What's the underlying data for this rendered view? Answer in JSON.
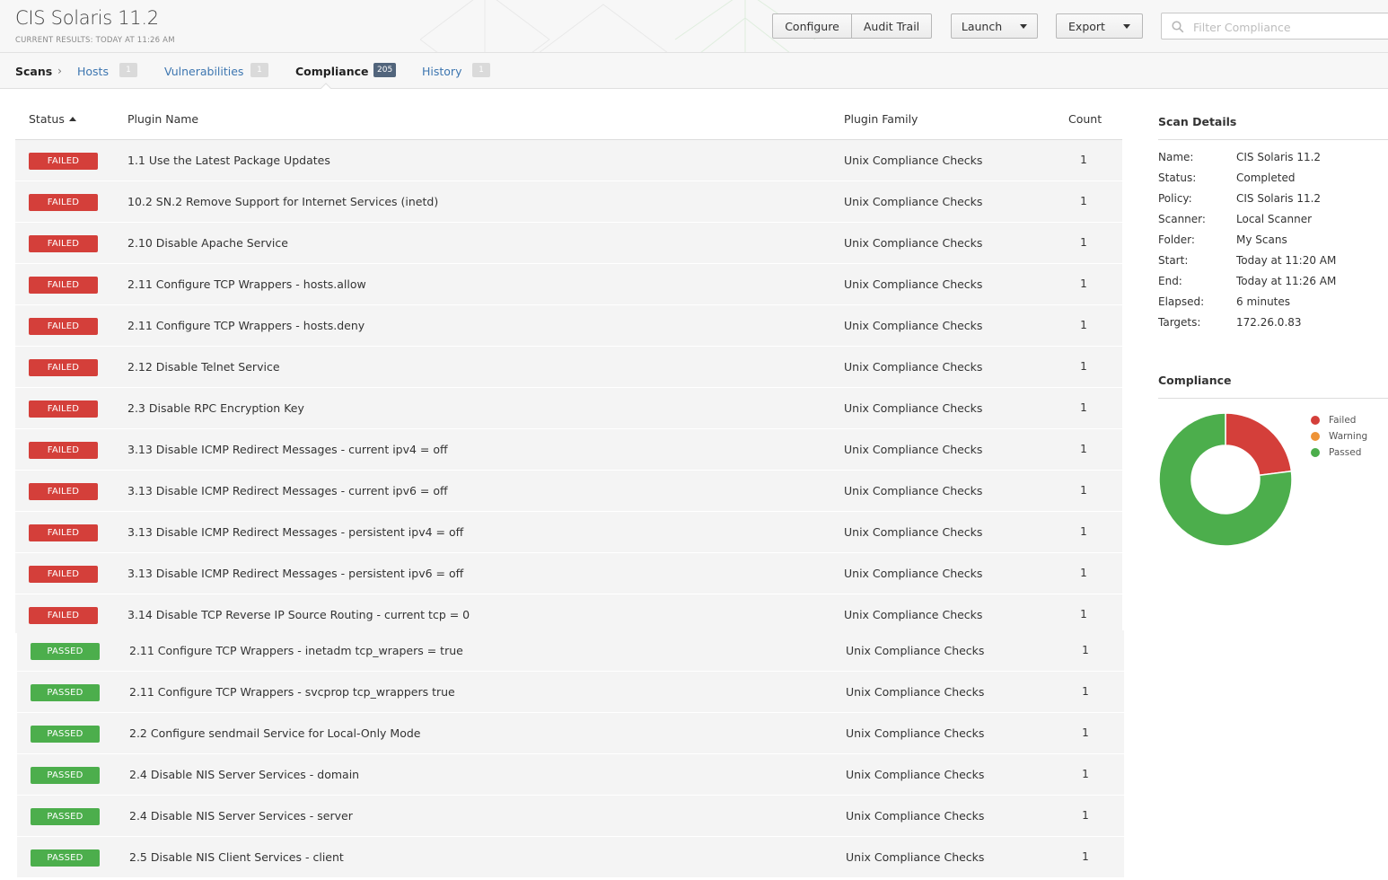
{
  "header": {
    "title": "CIS Solaris 11.2",
    "subtitle": "CURRENT RESULTS: TODAY AT 11:26 AM",
    "configure_label": "Configure",
    "audit_trail_label": "Audit Trail",
    "launch_label": "Launch",
    "export_label": "Export",
    "search_placeholder": "Filter Compliance"
  },
  "nav": {
    "root": "Scans",
    "tabs": [
      {
        "label": "Hosts",
        "count": "1"
      },
      {
        "label": "Vulnerabilities",
        "count": "1"
      },
      {
        "label": "Compliance",
        "count": "205",
        "active": true
      },
      {
        "label": "History",
        "count": "1"
      }
    ]
  },
  "table": {
    "columns": [
      "Status",
      "Plugin Name",
      "Plugin Family",
      "Count"
    ],
    "rows": [
      {
        "status": "FAILED",
        "name": "1.1 Use the Latest Package Updates",
        "family": "Unix Compliance Checks",
        "count": "1"
      },
      {
        "status": "FAILED",
        "name": "10.2 SN.2 Remove Support for Internet Services (inetd)",
        "family": "Unix Compliance Checks",
        "count": "1"
      },
      {
        "status": "FAILED",
        "name": "2.10 Disable Apache Service",
        "family": "Unix Compliance Checks",
        "count": "1"
      },
      {
        "status": "FAILED",
        "name": "2.11 Configure TCP Wrappers - hosts.allow",
        "family": "Unix Compliance Checks",
        "count": "1"
      },
      {
        "status": "FAILED",
        "name": "2.11 Configure TCP Wrappers - hosts.deny",
        "family": "Unix Compliance Checks",
        "count": "1"
      },
      {
        "status": "FAILED",
        "name": "2.12 Disable Telnet Service",
        "family": "Unix Compliance Checks",
        "count": "1"
      },
      {
        "status": "FAILED",
        "name": "2.3 Disable RPC Encryption Key",
        "family": "Unix Compliance Checks",
        "count": "1"
      },
      {
        "status": "FAILED",
        "name": "3.13 Disable ICMP Redirect Messages - current ipv4 = off",
        "family": "Unix Compliance Checks",
        "count": "1"
      },
      {
        "status": "FAILED",
        "name": "3.13 Disable ICMP Redirect Messages - current ipv6 = off",
        "family": "Unix Compliance Checks",
        "count": "1"
      },
      {
        "status": "FAILED",
        "name": "3.13 Disable ICMP Redirect Messages - persistent ipv4 = off",
        "family": "Unix Compliance Checks",
        "count": "1"
      },
      {
        "status": "FAILED",
        "name": "3.13 Disable ICMP Redirect Messages - persistent ipv6 = off",
        "family": "Unix Compliance Checks",
        "count": "1"
      },
      {
        "status": "FAILED",
        "name": "3.14 Disable TCP Reverse IP Source Routing - current tcp = 0",
        "family": "Unix Compliance Checks",
        "count": "1"
      },
      {
        "status": "PASSED",
        "name": "2.11 Configure TCP Wrappers - inetadm tcp_wrapers = true",
        "family": "Unix Compliance Checks",
        "count": "1"
      },
      {
        "status": "PASSED",
        "name": "2.11 Configure TCP Wrappers - svcprop tcp_wrappers true",
        "family": "Unix Compliance Checks",
        "count": "1"
      },
      {
        "status": "PASSED",
        "name": "2.2 Configure sendmail Service for Local-Only Mode",
        "family": "Unix Compliance Checks",
        "count": "1"
      },
      {
        "status": "PASSED",
        "name": "2.4 Disable NIS Server Services - domain",
        "family": "Unix Compliance Checks",
        "count": "1"
      },
      {
        "status": "PASSED",
        "name": "2.4 Disable NIS Server Services - server",
        "family": "Unix Compliance Checks",
        "count": "1"
      },
      {
        "status": "PASSED",
        "name": "2.5 Disable NIS Client Services - client",
        "family": "Unix Compliance Checks",
        "count": "1"
      }
    ]
  },
  "scan_details": {
    "title": "Scan Details",
    "items": [
      {
        "label": "Name:",
        "value": "CIS Solaris 11.2"
      },
      {
        "label": "Status:",
        "value": "Completed"
      },
      {
        "label": "Policy:",
        "value": "CIS Solaris 11.2"
      },
      {
        "label": "Scanner:",
        "value": "Local Scanner"
      },
      {
        "label": "Folder:",
        "value": "My Scans"
      },
      {
        "label": "Start:",
        "value": "Today at 11:20 AM"
      },
      {
        "label": "End:",
        "value": "Today at 11:26 AM"
      },
      {
        "label": "Elapsed:",
        "value": "6 minutes"
      },
      {
        "label": "Targets:",
        "value": "172.26.0.83"
      }
    ]
  },
  "compliance_chart": {
    "title": "Compliance",
    "colors": {
      "failed": "#d43f3a",
      "warning": "#ee9336",
      "passed": "#4cae4c"
    }
  },
  "chart_data": {
    "type": "pie",
    "series": [
      {
        "name": "Failed",
        "value": 23
      },
      {
        "name": "Warning",
        "value": 0
      },
      {
        "name": "Passed",
        "value": 77
      }
    ],
    "legend": "right"
  }
}
